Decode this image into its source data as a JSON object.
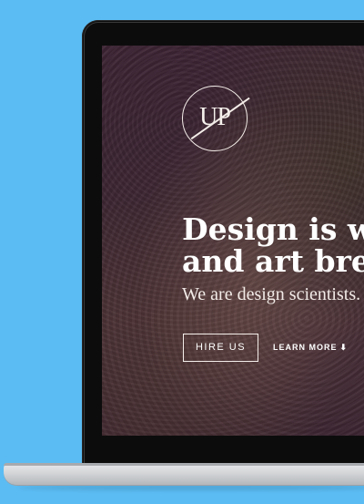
{
  "logo": {
    "text": "UP"
  },
  "hero": {
    "headline_line1": "Design is wh",
    "headline_line2": "and art brea",
    "subhead": "We are design scientists."
  },
  "actions": {
    "hire_label": "HIRE US",
    "learn_more_label": "LEARN MORE",
    "learn_more_icon": "⬇"
  },
  "colors": {
    "background": "#5bbcf3",
    "hero_overlay": "#3d2434",
    "text": "#ffffff"
  }
}
